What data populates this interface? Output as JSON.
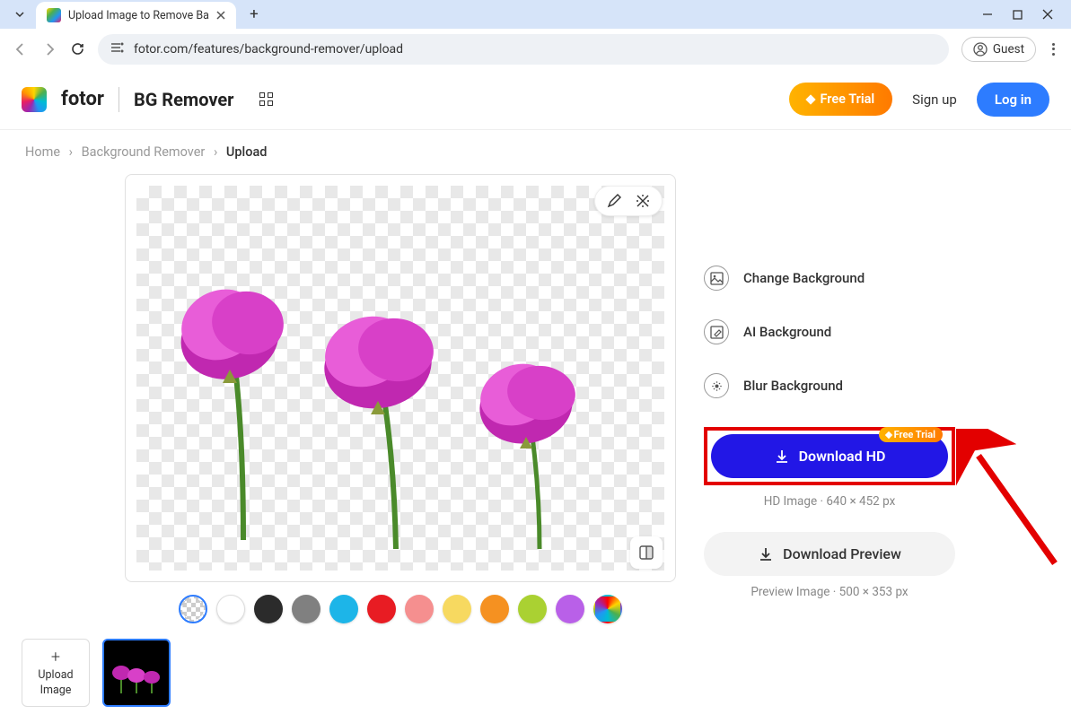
{
  "browser": {
    "tab_title": "Upload Image to Remove Ba",
    "url": "fotor.com/features/background-remover/upload",
    "profile": "Guest"
  },
  "header": {
    "brand": "fotor",
    "page_name": "BG Remover",
    "free_trial": "Free Trial",
    "signup": "Sign up",
    "login": "Log in"
  },
  "breadcrumb": {
    "home": "Home",
    "section": "Background Remover",
    "current": "Upload"
  },
  "options": {
    "change_bg": "Change Background",
    "ai_bg": "AI Background",
    "blur_bg": "Blur Background"
  },
  "download": {
    "hd_label": "Download HD",
    "hd_badge": "Free Trial",
    "hd_info": "HD Image · 640 × 452 px",
    "preview_label": "Download Preview",
    "preview_info": "Preview Image · 500 × 353 px"
  },
  "thumbnails": {
    "upload_plus": "+",
    "upload_label": "Upload Image"
  },
  "swatches": [
    {
      "color": "transparent",
      "selected": true
    },
    {
      "color": "#ffffff"
    },
    {
      "color": "#2b2b2b"
    },
    {
      "color": "#808080"
    },
    {
      "color": "#1db5e8"
    },
    {
      "color": "#e81c23"
    },
    {
      "color": "#f58f8f"
    },
    {
      "color": "#f7d960"
    },
    {
      "color": "#f59121"
    },
    {
      "color": "#aad132"
    },
    {
      "color": "#b960e8"
    },
    {
      "color": "rainbow"
    }
  ]
}
